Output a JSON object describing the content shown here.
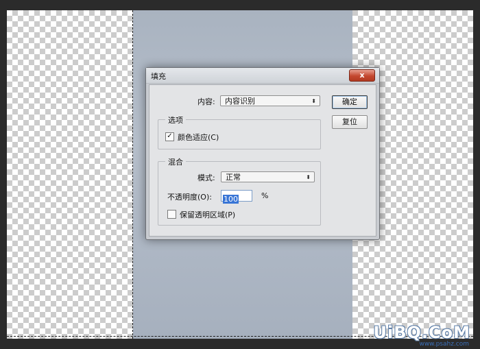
{
  "dialog": {
    "title": "填充",
    "close_label": "x",
    "content_label": "内容:",
    "content_value": "内容识别",
    "ok_label": "确定",
    "reset_label": "复位",
    "options_group": "选项",
    "color_adapt_label": "颜色适应(C)",
    "color_adapt_checked": true,
    "blend_group": "混合",
    "mode_label": "模式:",
    "mode_value": "正常",
    "opacity_label": "不透明度(O):",
    "opacity_value": "100",
    "opacity_unit": "%",
    "preserve_label": "保留透明区域(P)",
    "preserve_checked": false,
    "check_mark": "✓"
  },
  "watermark": {
    "text": "UiBQ.CoM",
    "sub": "www.psahz.com"
  }
}
